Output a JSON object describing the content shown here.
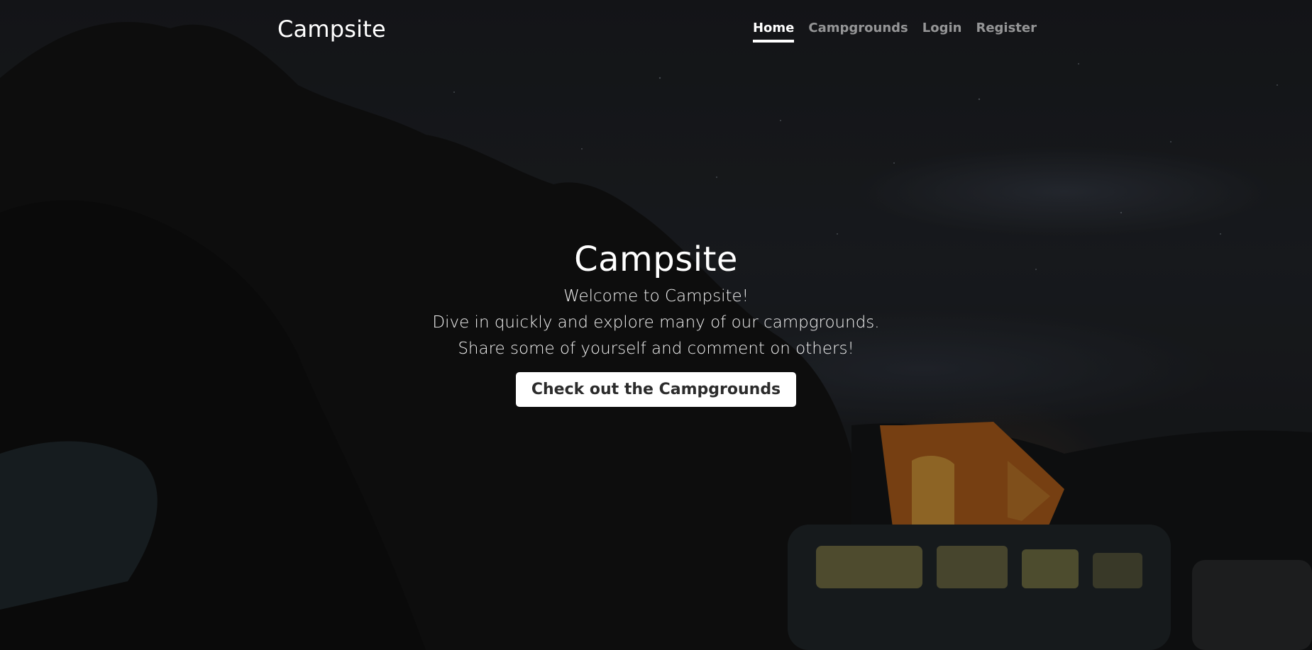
{
  "nav": {
    "brand": "Campsite",
    "links": [
      {
        "label": "Home",
        "active": true
      },
      {
        "label": "Campgrounds",
        "active": false
      },
      {
        "label": "Login",
        "active": false
      },
      {
        "label": "Register",
        "active": false
      }
    ]
  },
  "hero": {
    "title": "Campsite",
    "lines": [
      "Welcome to Campsite!",
      "Dive in quickly and explore many of our campgrounds.",
      "Share some of yourself and comment on others!"
    ],
    "cta_label": "Check out the Campgrounds"
  },
  "colors": {
    "text": "#ffffff",
    "nav_inactive": "rgba(255,255,255,0.55)",
    "button_bg": "#ffffff",
    "button_text": "#2b2b2b"
  }
}
